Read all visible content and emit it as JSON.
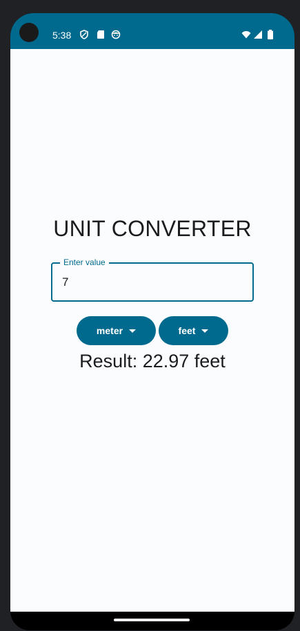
{
  "status_bar": {
    "time": "5:38",
    "left_icons": [
      "shield-icon",
      "sd-card-icon",
      "face-icon"
    ],
    "right_icons": [
      "wifi-icon",
      "cell-signal-icon",
      "battery-icon"
    ],
    "color": "#006a8e"
  },
  "app": {
    "title": "UNIT CONVERTER",
    "input": {
      "label": "Enter value",
      "value": "7"
    },
    "from_unit": "meter",
    "to_unit": "feet",
    "result": "Result: 22.97 feet",
    "accent_color": "#006a8e"
  }
}
